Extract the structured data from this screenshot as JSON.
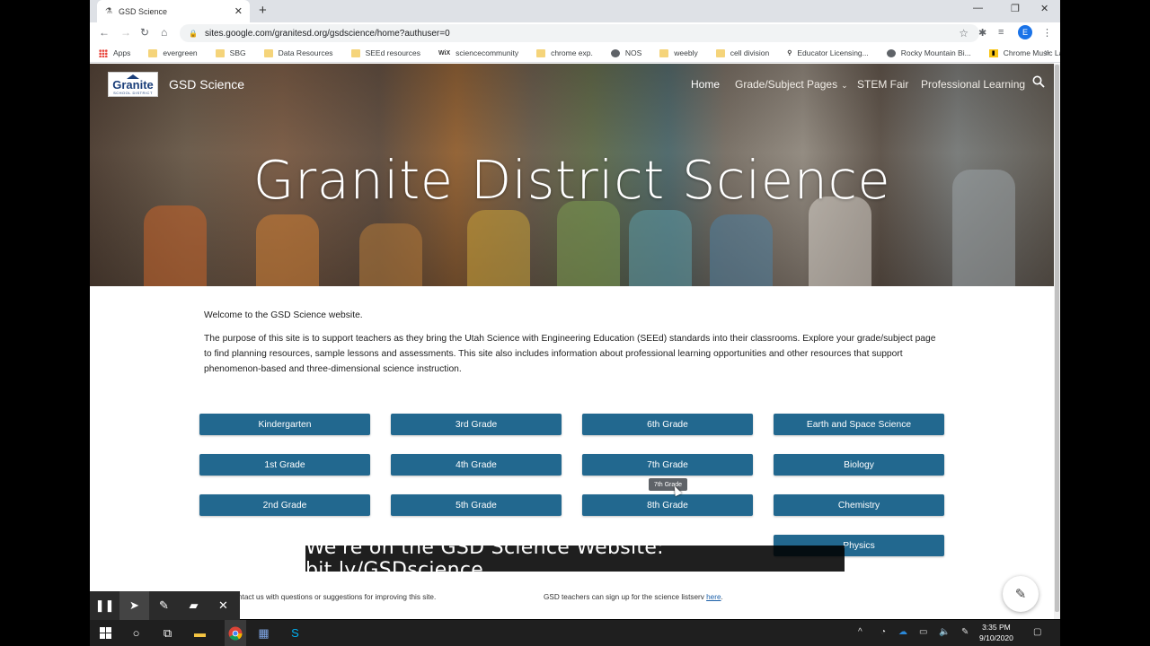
{
  "browser": {
    "tab_title": "GSD Science",
    "url": "sites.google.com/granitesd.org/gsdscience/home?authuser=0",
    "profile_initial": "E",
    "bookmarks": [
      {
        "label": "Apps",
        "icon": "apps-icon"
      },
      {
        "label": "evergreen",
        "icon": "folder-icon"
      },
      {
        "label": "SBG",
        "icon": "folder-icon"
      },
      {
        "label": "Data Resources",
        "icon": "folder-icon"
      },
      {
        "label": "SEEd resources",
        "icon": "folder-icon"
      },
      {
        "label": "sciencecommunity",
        "icon": "wix-icon"
      },
      {
        "label": "chrome exp.",
        "icon": "folder-icon"
      },
      {
        "label": "NOS",
        "icon": "globe-icon"
      },
      {
        "label": "weebly",
        "icon": "folder-icon"
      },
      {
        "label": "cell division",
        "icon": "folder-icon"
      },
      {
        "label": "Educator Licensing...",
        "icon": "link-icon"
      },
      {
        "label": "Rocky Mountain Bi...",
        "icon": "globe-icon"
      },
      {
        "label": "Chrome Music Lab",
        "icon": "music-lab-icon"
      }
    ]
  },
  "site": {
    "logo_text": "Granite",
    "logo_subtext": "SCHOOL DISTRICT",
    "name": "GSD Science",
    "nav": {
      "home": "Home",
      "grade_subject": "Grade/Subject Pages",
      "stem_fair": "STEM Fair",
      "professional_learning": "Professional Learning"
    },
    "hero_title": "Granite District Science",
    "welcome": "Welcome to the GSD Science website.",
    "purpose": "The purpose of this site is to support teachers as they bring the Utah Science with Engineering Education (SEEd) standards into their classrooms.   Explore your grade/subject page to find planning resources, sample lessons and assessments. This site also includes information about professional learning opportunities and other resources that support phenomenon-based and three-dimensional science instruction.",
    "buttons": {
      "col1": [
        "Kindergarten",
        "1st Grade",
        "2nd Grade"
      ],
      "col2": [
        "3rd Grade",
        "4th Grade",
        "5th Grade"
      ],
      "col3": [
        "6th Grade",
        "7th Grade",
        "8th Grade"
      ],
      "col4": [
        "Earth and Space Science",
        "Biology",
        "Chemistry",
        "Physics"
      ]
    },
    "tooltip": "7th Grade",
    "footer_left": "ntact us with questions or suggestions for improving this site.",
    "footer_right": "GSD teachers can sign up for the science listserv ",
    "footer_link": "here",
    "footer_period": "."
  },
  "caption": "We're on the GSD Science Website: bit.ly/GSDscience",
  "taskbar": {
    "time": "3:35 PM",
    "date": "9/10/2020"
  },
  "colors": {
    "button_blue": "#22688f",
    "taskbar": "#1f1f1f",
    "tab_strip": "#dee1e6"
  }
}
